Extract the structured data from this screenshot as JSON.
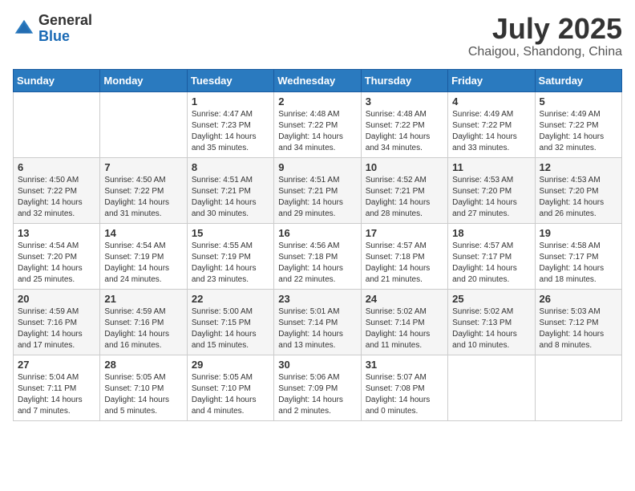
{
  "logo": {
    "general": "General",
    "blue": "Blue"
  },
  "header": {
    "month": "July 2025",
    "location": "Chaigou, Shandong, China"
  },
  "weekdays": [
    "Sunday",
    "Monday",
    "Tuesday",
    "Wednesday",
    "Thursday",
    "Friday",
    "Saturday"
  ],
  "weeks": [
    [
      {
        "day": "",
        "content": ""
      },
      {
        "day": "",
        "content": ""
      },
      {
        "day": "1",
        "content": "Sunrise: 4:47 AM\nSunset: 7:23 PM\nDaylight: 14 hours\nand 35 minutes."
      },
      {
        "day": "2",
        "content": "Sunrise: 4:48 AM\nSunset: 7:22 PM\nDaylight: 14 hours\nand 34 minutes."
      },
      {
        "day": "3",
        "content": "Sunrise: 4:48 AM\nSunset: 7:22 PM\nDaylight: 14 hours\nand 34 minutes."
      },
      {
        "day": "4",
        "content": "Sunrise: 4:49 AM\nSunset: 7:22 PM\nDaylight: 14 hours\nand 33 minutes."
      },
      {
        "day": "5",
        "content": "Sunrise: 4:49 AM\nSunset: 7:22 PM\nDaylight: 14 hours\nand 32 minutes."
      }
    ],
    [
      {
        "day": "6",
        "content": "Sunrise: 4:50 AM\nSunset: 7:22 PM\nDaylight: 14 hours\nand 32 minutes."
      },
      {
        "day": "7",
        "content": "Sunrise: 4:50 AM\nSunset: 7:22 PM\nDaylight: 14 hours\nand 31 minutes."
      },
      {
        "day": "8",
        "content": "Sunrise: 4:51 AM\nSunset: 7:21 PM\nDaylight: 14 hours\nand 30 minutes."
      },
      {
        "day": "9",
        "content": "Sunrise: 4:51 AM\nSunset: 7:21 PM\nDaylight: 14 hours\nand 29 minutes."
      },
      {
        "day": "10",
        "content": "Sunrise: 4:52 AM\nSunset: 7:21 PM\nDaylight: 14 hours\nand 28 minutes."
      },
      {
        "day": "11",
        "content": "Sunrise: 4:53 AM\nSunset: 7:20 PM\nDaylight: 14 hours\nand 27 minutes."
      },
      {
        "day": "12",
        "content": "Sunrise: 4:53 AM\nSunset: 7:20 PM\nDaylight: 14 hours\nand 26 minutes."
      }
    ],
    [
      {
        "day": "13",
        "content": "Sunrise: 4:54 AM\nSunset: 7:20 PM\nDaylight: 14 hours\nand 25 minutes."
      },
      {
        "day": "14",
        "content": "Sunrise: 4:54 AM\nSunset: 7:19 PM\nDaylight: 14 hours\nand 24 minutes."
      },
      {
        "day": "15",
        "content": "Sunrise: 4:55 AM\nSunset: 7:19 PM\nDaylight: 14 hours\nand 23 minutes."
      },
      {
        "day": "16",
        "content": "Sunrise: 4:56 AM\nSunset: 7:18 PM\nDaylight: 14 hours\nand 22 minutes."
      },
      {
        "day": "17",
        "content": "Sunrise: 4:57 AM\nSunset: 7:18 PM\nDaylight: 14 hours\nand 21 minutes."
      },
      {
        "day": "18",
        "content": "Sunrise: 4:57 AM\nSunset: 7:17 PM\nDaylight: 14 hours\nand 20 minutes."
      },
      {
        "day": "19",
        "content": "Sunrise: 4:58 AM\nSunset: 7:17 PM\nDaylight: 14 hours\nand 18 minutes."
      }
    ],
    [
      {
        "day": "20",
        "content": "Sunrise: 4:59 AM\nSunset: 7:16 PM\nDaylight: 14 hours\nand 17 minutes."
      },
      {
        "day": "21",
        "content": "Sunrise: 4:59 AM\nSunset: 7:16 PM\nDaylight: 14 hours\nand 16 minutes."
      },
      {
        "day": "22",
        "content": "Sunrise: 5:00 AM\nSunset: 7:15 PM\nDaylight: 14 hours\nand 15 minutes."
      },
      {
        "day": "23",
        "content": "Sunrise: 5:01 AM\nSunset: 7:14 PM\nDaylight: 14 hours\nand 13 minutes."
      },
      {
        "day": "24",
        "content": "Sunrise: 5:02 AM\nSunset: 7:14 PM\nDaylight: 14 hours\nand 11 minutes."
      },
      {
        "day": "25",
        "content": "Sunrise: 5:02 AM\nSunset: 7:13 PM\nDaylight: 14 hours\nand 10 minutes."
      },
      {
        "day": "26",
        "content": "Sunrise: 5:03 AM\nSunset: 7:12 PM\nDaylight: 14 hours\nand 8 minutes."
      }
    ],
    [
      {
        "day": "27",
        "content": "Sunrise: 5:04 AM\nSunset: 7:11 PM\nDaylight: 14 hours\nand 7 minutes."
      },
      {
        "day": "28",
        "content": "Sunrise: 5:05 AM\nSunset: 7:10 PM\nDaylight: 14 hours\nand 5 minutes."
      },
      {
        "day": "29",
        "content": "Sunrise: 5:05 AM\nSunset: 7:10 PM\nDaylight: 14 hours\nand 4 minutes."
      },
      {
        "day": "30",
        "content": "Sunrise: 5:06 AM\nSunset: 7:09 PM\nDaylight: 14 hours\nand 2 minutes."
      },
      {
        "day": "31",
        "content": "Sunrise: 5:07 AM\nSunset: 7:08 PM\nDaylight: 14 hours\nand 0 minutes."
      },
      {
        "day": "",
        "content": ""
      },
      {
        "day": "",
        "content": ""
      }
    ]
  ]
}
